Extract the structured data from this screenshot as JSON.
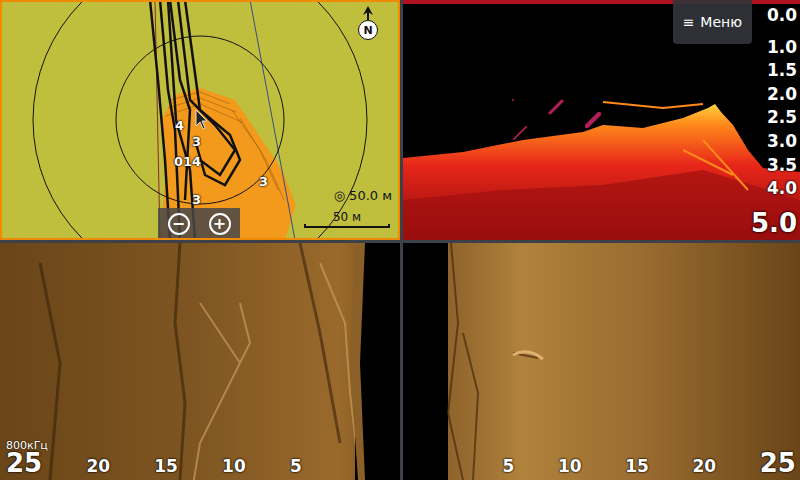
{
  "map": {
    "selected": true,
    "north": "N",
    "range_icon": "◎",
    "range": "50.0 м",
    "scale": "50 м",
    "depth_labels": [
      "4",
      "3",
      "014",
      "3",
      "3"
    ],
    "zoom_buttons": [
      "−",
      "+"
    ]
  },
  "sonar": {
    "menu_icon": "≡",
    "menu": "Меню",
    "depth_scale": [
      "0.0",
      "1.0",
      "1.5",
      "2.0",
      "2.5",
      "3.0",
      "3.5",
      "4.0"
    ],
    "max_depth": "5.0"
  },
  "sidescan": {
    "frequency": "800кГц",
    "left_ticks": [
      "25",
      "20",
      "15",
      "10",
      "5"
    ],
    "right_ticks": [
      "5",
      "10",
      "15",
      "20",
      "25"
    ]
  }
}
